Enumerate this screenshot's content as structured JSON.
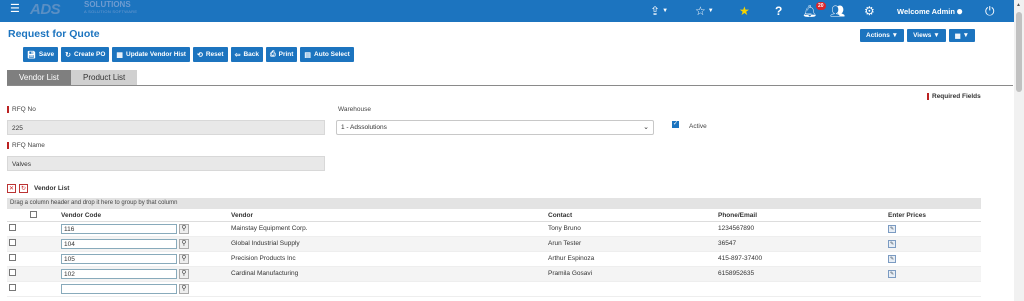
{
  "header": {
    "logo_mark": "ADS",
    "logo_word": "SOLUTIONS",
    "logo_tag": "A SOLUTION SOFTWARE",
    "notification_count": "20",
    "welcome": "Welcome Admin"
  },
  "page_title": "Request for Quote",
  "toolbar": {
    "save": "Save",
    "create_po": "Create PO",
    "update_vendor_hist": "Update Vendor Hist",
    "reset": "Reset",
    "back": "Back",
    "print": "Print",
    "auto_select": "Auto Select"
  },
  "right_buttons": {
    "actions": "Actions",
    "views": "Views"
  },
  "tabs": [
    "Vendor List",
    "Product List"
  ],
  "required_fields": "Required Fields",
  "form": {
    "rfq_no_label": "RFQ No",
    "rfq_no_value": "225",
    "warehouse_label": "Warehouse",
    "warehouse_value": "1 - Adssolutions",
    "active_label": "Active",
    "rfq_name_label": "RFQ Name",
    "rfq_name_value": "Valves"
  },
  "vendor_list": {
    "title": "Vendor List",
    "group_hint": "Drag a column header and drop it here to group by that column",
    "columns": [
      "Vendor Code",
      "Vendor",
      "Contact",
      "Phone/Email",
      "Enter Prices"
    ],
    "rows": [
      {
        "code": "116",
        "vendor": "Mainstay Equipment Corp.",
        "contact": "Tony Bruno",
        "phone": "1234567890"
      },
      {
        "code": "104",
        "vendor": "Global Industrial Supply",
        "contact": "Arun Tester",
        "phone": "36547"
      },
      {
        "code": "105",
        "vendor": "Precision Products Inc",
        "contact": "Arthur Espinoza",
        "phone": "415-897-37400"
      },
      {
        "code": "102",
        "vendor": "Cardinal Manufacturing",
        "contact": "Pramila Gosavi",
        "phone": "6158952635"
      }
    ]
  }
}
